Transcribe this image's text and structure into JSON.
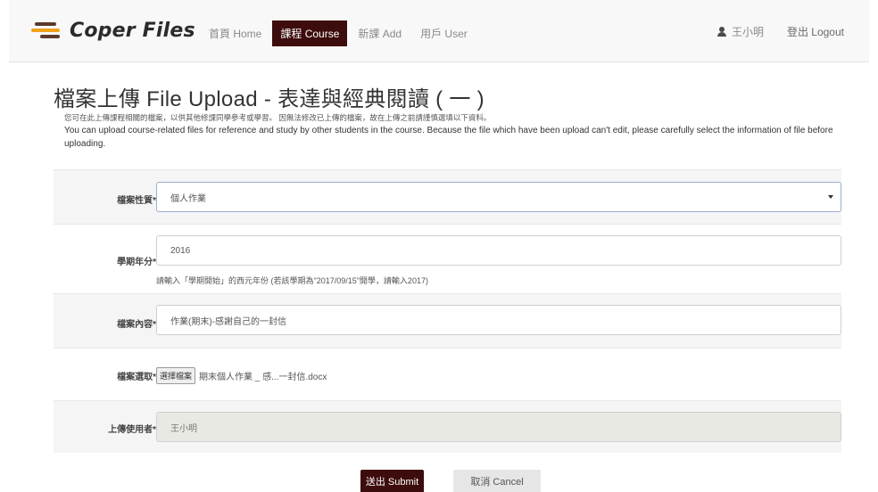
{
  "brand": {
    "name": "Coper Files"
  },
  "nav": {
    "items": [
      {
        "label": "首頁 Home",
        "active": false
      },
      {
        "label": "課程 Course",
        "active": true
      },
      {
        "label": "新課 Add",
        "active": false
      },
      {
        "label": "用戶 User",
        "active": false
      }
    ],
    "user_name": "王小明",
    "logout_label": "登出 Logout"
  },
  "page": {
    "title": "檔案上傳 File Upload - 表達與經典閱讀 ( 一 )",
    "description_zh": "您可在此上傳課程相關的檔案，以供其他修課同學參考或學習。 因無法修改已上傳的檔案，故在上傳之前請謹慎選填以下資料。",
    "description_en": "You can upload course-related files for reference and study by other students in the course. Because the file which have been upload can't edit, please carefully select the information of file before uploading."
  },
  "form": {
    "file_type": {
      "label": "檔案性質*",
      "value": "個人作業"
    },
    "year": {
      "label": "學期年分*",
      "value": "2016",
      "help": "請輸入「學期開始」的西元年份 (若該學期為\"2017/09/15\"開學，請輸入2017)"
    },
    "content": {
      "label": "檔案內容*",
      "value": "作業(期末)-感謝自己的一封信"
    },
    "file": {
      "label": "檔案選取*",
      "button_label": "選擇檔案",
      "file_name": "期末個人作業 _ 感...一封信.docx"
    },
    "uploader": {
      "label": "上傳使用者*",
      "value": "王小明"
    }
  },
  "actions": {
    "submit_label": "送出 Submit",
    "cancel_label": "取消 Cancel"
  },
  "colors": {
    "accent": "#3d0c0c",
    "brand_brown": "#5b3a2c",
    "brand_orange": "#f0a21c"
  }
}
